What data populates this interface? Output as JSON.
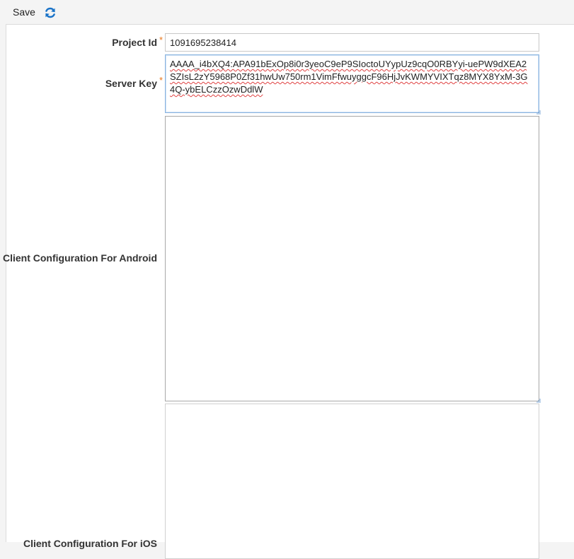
{
  "toolbar": {
    "save_label": "Save",
    "refresh_icon": "refresh-icon",
    "accent": "#1a73c8"
  },
  "form": {
    "project_id": {
      "label": "Project Id",
      "required_mark": "*",
      "value": "1091695238414"
    },
    "server_key": {
      "label": "Server Key",
      "required_mark": "*",
      "value": "AAAA_i4bXQ4:APA91bExOp8i0r3yeoC9eP9SIoctoUYypUz9cqO0RBYyi-uePW9dXEA2SZIsL2zY5968P0Zf31hwUw750rm1VimFfwuyggcF96HjJvKWMYVIXTqz8MYX8YxM-3G4Q-ybELCzzOzwDdlW"
    },
    "client_config_android": {
      "label": "Client Configuration For Android",
      "value": ""
    },
    "client_config_ios": {
      "label": "Client Configuration For iOS",
      "value": ""
    }
  },
  "colors": {
    "required": "#e8761c",
    "focus_border": "#8ab4e0",
    "spellcheck": "#e04040"
  }
}
